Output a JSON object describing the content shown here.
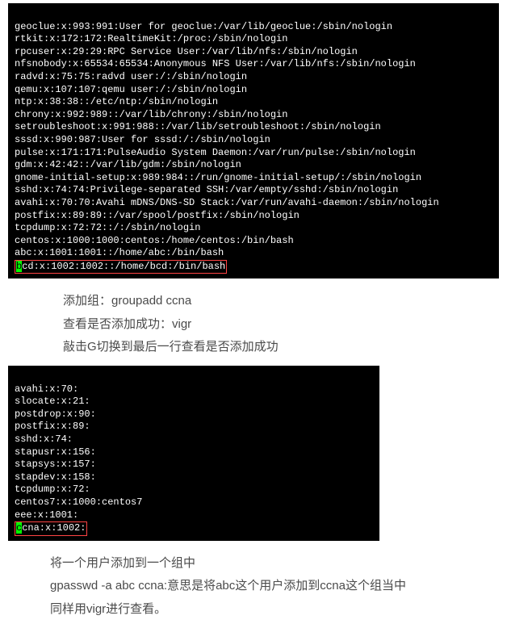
{
  "terminal1": {
    "lines": [
      "geoclue:x:993:991:User for geoclue:/var/lib/geoclue:/sbin/nologin",
      "rtkit:x:172:172:RealtimeKit:/proc:/sbin/nologin",
      "rpcuser:x:29:29:RPC Service User:/var/lib/nfs:/sbin/nologin",
      "nfsnobody:x:65534:65534:Anonymous NFS User:/var/lib/nfs:/sbin/nologin",
      "radvd:x:75:75:radvd user:/:/sbin/nologin",
      "qemu:x:107:107:qemu user:/:/sbin/nologin",
      "ntp:x:38:38::/etc/ntp:/sbin/nologin",
      "chrony:x:992:989::/var/lib/chrony:/sbin/nologin",
      "setroubleshoot:x:991:988::/var/lib/setroubleshoot:/sbin/nologin",
      "sssd:x:990:987:User for sssd:/:/sbin/nologin",
      "pulse:x:171:171:PulseAudio System Daemon:/var/run/pulse:/sbin/nologin",
      "gdm:x:42:42::/var/lib/gdm:/sbin/nologin",
      "gnome-initial-setup:x:989:984::/run/gnome-initial-setup/:/sbin/nologin",
      "sshd:x:74:74:Privilege-separated SSH:/var/empty/sshd:/sbin/nologin",
      "avahi:x:70:70:Avahi mDNS/DNS-SD Stack:/var/run/avahi-daemon:/sbin/nologin",
      "postfix:x:89:89::/var/spool/postfix:/sbin/nologin",
      "tcpdump:x:72:72::/:/sbin/nologin",
      "centos:x:1000:1000:centos:/home/centos:/bin/bash",
      "abc:x:1001:1001::/home/abc:/bin/bash"
    ],
    "highlight_prefix": "b",
    "highlight_rest": "cd:x:1002:1002::/home/bcd:/bin/bash"
  },
  "doc1": {
    "line1": "添加组：groupadd ccna",
    "line2": "查看是否添加成功：vigr",
    "line3": "敲击G切换到最后一行查看是否添加成功"
  },
  "terminal2": {
    "lines": [
      "avahi:x:70:",
      "slocate:x:21:",
      "postdrop:x:90:",
      "postfix:x:89:",
      "sshd:x:74:",
      "stapusr:x:156:",
      "stapsys:x:157:",
      "stapdev:x:158:",
      "tcpdump:x:72:",
      "centos7:x:1000:centos7",
      "eee:x:1001:"
    ],
    "highlight_prefix": "c",
    "highlight_rest": "cna:x:1002:"
  },
  "doc2": {
    "line1": "将一个用户添加到一个组中",
    "line2": "gpasswd -a abc ccna:意思是将abc这个用户添加到ccna这个组当中",
    "line3": "同样用vigr进行查看。"
  }
}
